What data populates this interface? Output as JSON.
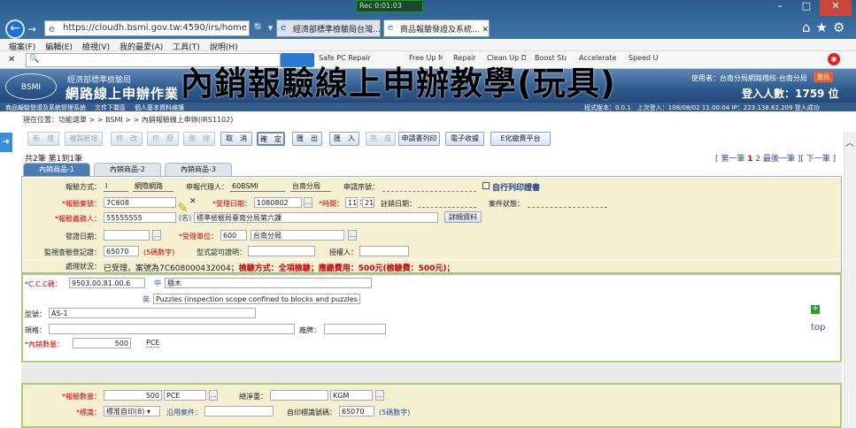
{
  "browser": {
    "url": "https://cloudh.bsmi.gov.tw:4590/irs/home",
    "tab1": "經濟部標準檢驗局台灣...",
    "tab2": "商品報驗發證及系統...",
    "rec": "Rec 0:01:03",
    "menu": [
      "檔案(F)",
      "編輯(E)",
      "檢視(V)",
      "我的最愛(A)",
      "工具(T)",
      "說明(H)"
    ],
    "toolbar": [
      "Safe PC Repair",
      "Free Up Memory",
      "Repair Issues",
      "Clean Up Disk",
      "Boost Startup",
      "Accelerate Internet",
      "Speed Up"
    ]
  },
  "header": {
    "org": "經濟部標準檢驗局",
    "system": "網路線上申辦作業",
    "logo": "BSMI",
    "overlay": "內銷報驗線上申辦教學(玩具)",
    "user": "使用者：台南分局網路稽核-台南分局",
    "logout": "登出",
    "visitors": "登入人數：1759 位",
    "links": [
      "商品報驗發證及系統管理系統",
      "文件下載區",
      "個人基本資料維護"
    ],
    "version": "程式版本：0.0.1　上次登入：108/08/02 11:00:04 IP：223.138.62.209 登入成功"
  },
  "breadcrumb": "現在位置：功能選單 > > BSMI > > 內銷報驗線上申辦(IRS1102)",
  "buttons": [
    "新　增",
    "複製新增",
    "修　改",
    "作　廢",
    "刪　除",
    "取　消",
    "確　定",
    "匯　出",
    "匯　入",
    "完　成",
    "申請書列印",
    "電子收據",
    "E化繳費平台"
  ],
  "pagecount": "共2筆 第1到1筆",
  "pager": {
    "first": "第一筆",
    "p1": "1",
    "p2": "2",
    "last": "最後一筆",
    "next": "下一筆"
  },
  "tabs": [
    "內銷商品-1",
    "內銷商品-2",
    "內銷商品-3"
  ],
  "form": {
    "inspect_method_label": "報驗方式：",
    "inspect_method_code": "I",
    "inspect_method_value": "網際網路",
    "agent_label": "申報代理人：",
    "agent_value": "60BSMI",
    "agent_unit": "台南分局",
    "serial_label": "申請序號：",
    "self_print": "自行列印證書",
    "case_no_label": "*報驗案號：",
    "case_no": "7C608",
    "accept_date_label": "*受理日期：",
    "accept_date": "1080802",
    "time_label": "*時間：",
    "hour": "11",
    "minute": "21",
    "cancel_date_label": "註銷日期：",
    "case_status_label": "案件狀態：",
    "applicant_label": "*報驗義務人：",
    "applicant": "55555555",
    "applicant_tag": "(名)",
    "applicant_name": "標準檢驗局臺南分局第六課",
    "detail_btn": "詳細資料",
    "issue_date_label": "發證日期：",
    "accept_unit_label": "*受理單位：",
    "accept_unit_code": "600",
    "accept_unit_name": "台南分局",
    "reg_label": "監視查驗登記證：",
    "reg_no": "65070",
    "reg_hint": "(5碼數字)",
    "type_cert_label": "型式認可證明：",
    "authorizer_label": "授權人：",
    "status_label": "處理狀況：",
    "status_pre": "已受理，案號為7C608000432004；",
    "status_method": "檢驗方式：全項檢驗；",
    "status_fee": "應繳費用：500元(檢驗費：500元)；"
  },
  "item": {
    "ccc_label": "*C.C.C碼：",
    "ccc": "9503.00.81.00.6",
    "zh_tag": "中",
    "zh_name": "積木",
    "en_tag": "英",
    "en_name": "Puzzles (inspection scope confined to blocks and puzzles (",
    "model_label": "型號：",
    "model": "AS-1",
    "spec_label": "規格：",
    "brand_label": "廠牌：",
    "qty_label": "*內銷數量：",
    "qty": "500",
    "unit": "PCE",
    "top": "top"
  },
  "bottom": {
    "qty_label": "*報驗數量：",
    "qty": "500",
    "unit": "PCE",
    "net_label": "總淨重：",
    "weight_unit": "KGM",
    "mark_label": "*標識：",
    "mark_value": "標准自印(8)",
    "cite_label": "沿用案件：",
    "self_mark_label": "自印標識號碼：",
    "self_mark": "65070",
    "self_mark_hint": "(5碼數字)"
  }
}
